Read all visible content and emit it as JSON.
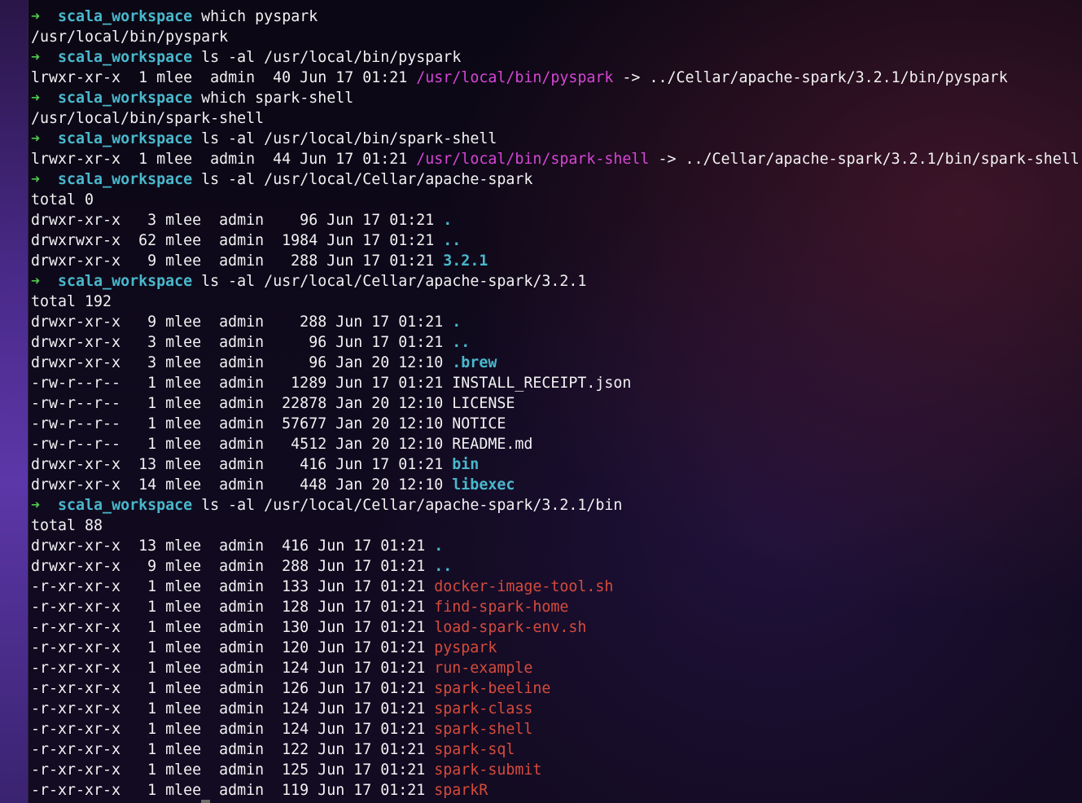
{
  "terminal": {
    "prompt_symbol": "➜",
    "prompt_dir": "scala_workspace",
    "lines": [
      {
        "type": "prompt",
        "cmd": "which pyspark"
      },
      {
        "type": "out",
        "text": "/usr/local/bin/pyspark"
      },
      {
        "type": "prompt",
        "cmd": "ls -al /usr/local/bin/pyspark"
      },
      {
        "type": "link",
        "pre": "lrwxr-xr-x  1 mlee  admin  40 Jun 17 01:21 ",
        "link": "/usr/local/bin/pyspark",
        "post": " -> ../Cellar/apache-spark/3.2.1/bin/pyspark"
      },
      {
        "type": "prompt",
        "cmd": "which spark-shell"
      },
      {
        "type": "out",
        "text": "/usr/local/bin/spark-shell"
      },
      {
        "type": "prompt",
        "cmd": "ls -al /usr/local/bin/spark-shell"
      },
      {
        "type": "link",
        "pre": "lrwxr-xr-x  1 mlee  admin  44 Jun 17 01:21 ",
        "link": "/usr/local/bin/spark-shell",
        "post": " -> ../Cellar/apache-spark/3.2.1/bin/spark-shell"
      },
      {
        "type": "prompt",
        "cmd": "ls -al /usr/local/Cellar/apache-spark"
      },
      {
        "type": "out",
        "text": "total 0"
      },
      {
        "type": "entry",
        "meta": "drwxr-xr-x   3 mlee  admin    96 Jun 17 01:21 ",
        "name": ".",
        "style": "cyanb"
      },
      {
        "type": "entry",
        "meta": "drwxrwxr-x  62 mlee  admin  1984 Jun 17 01:21 ",
        "name": "..",
        "style": "cyanb"
      },
      {
        "type": "entry",
        "meta": "drwxr-xr-x   9 mlee  admin   288 Jun 17 01:21 ",
        "name": "3.2.1",
        "style": "cyanb"
      },
      {
        "type": "prompt",
        "cmd": "ls -al /usr/local/Cellar/apache-spark/3.2.1"
      },
      {
        "type": "out",
        "text": "total 192"
      },
      {
        "type": "entry",
        "meta": "drwxr-xr-x   9 mlee  admin    288 Jun 17 01:21 ",
        "name": ".",
        "style": "cyanb"
      },
      {
        "type": "entry",
        "meta": "drwxr-xr-x   3 mlee  admin     96 Jun 17 01:21 ",
        "name": "..",
        "style": "cyanb"
      },
      {
        "type": "entry",
        "meta": "drwxr-xr-x   3 mlee  admin     96 Jan 20 12:10 ",
        "name": ".brew",
        "style": "cyanb"
      },
      {
        "type": "entry",
        "meta": "-rw-r--r--   1 mlee  admin   1289 Jun 17 01:21 ",
        "name": "INSTALL_RECEIPT.json",
        "style": "out"
      },
      {
        "type": "entry",
        "meta": "-rw-r--r--   1 mlee  admin  22878 Jan 20 12:10 ",
        "name": "LICENSE",
        "style": "out"
      },
      {
        "type": "entry",
        "meta": "-rw-r--r--   1 mlee  admin  57677 Jan 20 12:10 ",
        "name": "NOTICE",
        "style": "out"
      },
      {
        "type": "entry",
        "meta": "-rw-r--r--   1 mlee  admin   4512 Jan 20 12:10 ",
        "name": "README.md",
        "style": "out"
      },
      {
        "type": "entry",
        "meta": "drwxr-xr-x  13 mlee  admin    416 Jun 17 01:21 ",
        "name": "bin",
        "style": "cyanb"
      },
      {
        "type": "entry",
        "meta": "drwxr-xr-x  14 mlee  admin    448 Jan 20 12:10 ",
        "name": "libexec",
        "style": "cyanb"
      },
      {
        "type": "prompt",
        "cmd": "ls -al /usr/local/Cellar/apache-spark/3.2.1/bin"
      },
      {
        "type": "out",
        "text": "total 88"
      },
      {
        "type": "entry",
        "meta": "drwxr-xr-x  13 mlee  admin  416 Jun 17 01:21 ",
        "name": ".",
        "style": "cyanb"
      },
      {
        "type": "entry",
        "meta": "drwxr-xr-x   9 mlee  admin  288 Jun 17 01:21 ",
        "name": "..",
        "style": "cyanb"
      },
      {
        "type": "entry",
        "meta": "-r-xr-xr-x   1 mlee  admin  133 Jun 17 01:21 ",
        "name": "docker-image-tool.sh",
        "style": "red"
      },
      {
        "type": "entry",
        "meta": "-r-xr-xr-x   1 mlee  admin  128 Jun 17 01:21 ",
        "name": "find-spark-home",
        "style": "red"
      },
      {
        "type": "entry",
        "meta": "-r-xr-xr-x   1 mlee  admin  130 Jun 17 01:21 ",
        "name": "load-spark-env.sh",
        "style": "red"
      },
      {
        "type": "entry",
        "meta": "-r-xr-xr-x   1 mlee  admin  120 Jun 17 01:21 ",
        "name": "pyspark",
        "style": "red"
      },
      {
        "type": "entry",
        "meta": "-r-xr-xr-x   1 mlee  admin  124 Jun 17 01:21 ",
        "name": "run-example",
        "style": "red"
      },
      {
        "type": "entry",
        "meta": "-r-xr-xr-x   1 mlee  admin  126 Jun 17 01:21 ",
        "name": "spark-beeline",
        "style": "red"
      },
      {
        "type": "entry",
        "meta": "-r-xr-xr-x   1 mlee  admin  124 Jun 17 01:21 ",
        "name": "spark-class",
        "style": "red"
      },
      {
        "type": "entry",
        "meta": "-r-xr-xr-x   1 mlee  admin  124 Jun 17 01:21 ",
        "name": "spark-shell",
        "style": "red"
      },
      {
        "type": "entry",
        "meta": "-r-xr-xr-x   1 mlee  admin  122 Jun 17 01:21 ",
        "name": "spark-sql",
        "style": "red"
      },
      {
        "type": "entry",
        "meta": "-r-xr-xr-x   1 mlee  admin  125 Jun 17 01:21 ",
        "name": "spark-submit",
        "style": "red"
      },
      {
        "type": "entry",
        "meta": "-r-xr-xr-x   1 mlee  admin  119 Jun 17 01:21 ",
        "name": "sparkR",
        "style": "red"
      }
    ]
  }
}
